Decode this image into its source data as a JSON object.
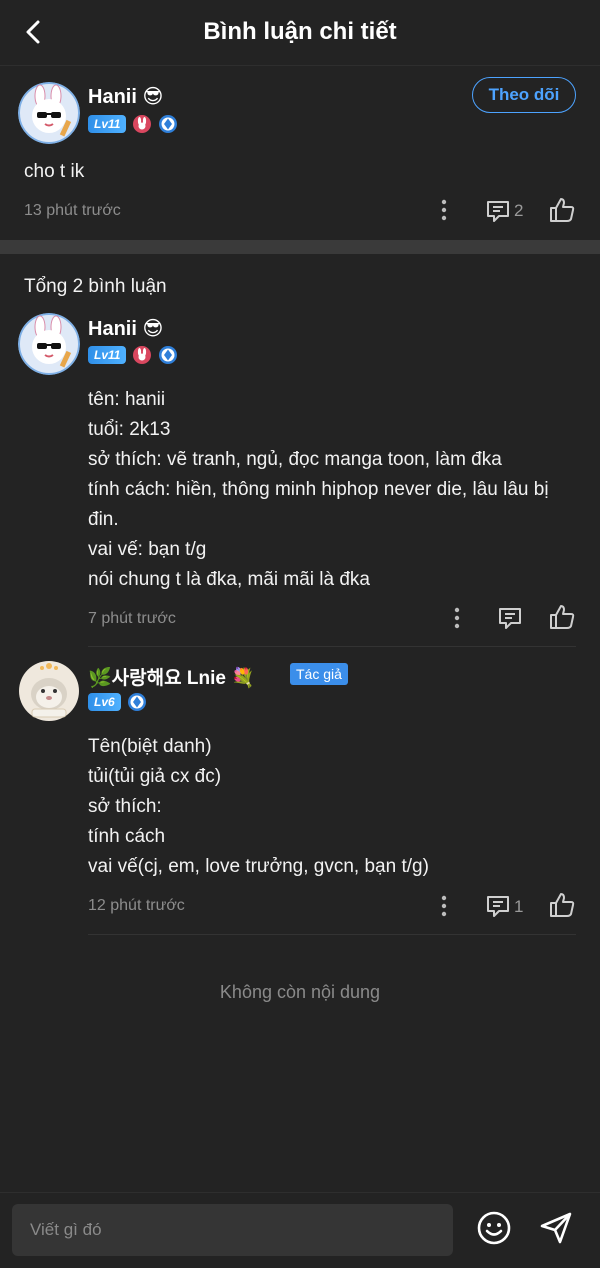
{
  "header": {
    "title": "Bình luận chi tiết"
  },
  "post": {
    "username": "Hanii 😎",
    "level": "Lv11",
    "follow_label": "Theo dõi",
    "text": "cho t ik",
    "time": "13 phút trước",
    "reply_count": "2"
  },
  "comments_total": "Tổng 2 bình luận",
  "comments": [
    {
      "username": "Hanii 😎",
      "level": "Lv11",
      "lines": [
        "tên: hanii",
        "tuổi: 2k13",
        "sở thích: vẽ tranh, ngủ, đọc manga toon, làm đka",
        "tính cách: hiền, thông minh hiphop never die, lâu lâu bị",
        "đin.",
        "vai vế: bạn t/g",
        "nói chung t là đka, mãi mãi là đka"
      ],
      "time": "7 phút trước"
    },
    {
      "username": "🌿사랑해요 Lnie 💐",
      "author_tag": "Tác giả",
      "level": "Lv6",
      "lines": [
        "Tên(biệt danh)",
        "tủi(tủi giả cx đc)",
        "sở thích:",
        "tính cách",
        "vai vế(cj, em, love trưởng, gvcn, bạn t/g)"
      ],
      "time": "12 phút trước",
      "reply_count": "1"
    }
  ],
  "end_text": "Không còn nội dung",
  "composer": {
    "placeholder": "Viết gì đó"
  },
  "colors": {
    "background": "#232323",
    "accent": "#4da3ff",
    "level_badge": "#3b8eea",
    "muted_text": "#8d8d8d"
  }
}
